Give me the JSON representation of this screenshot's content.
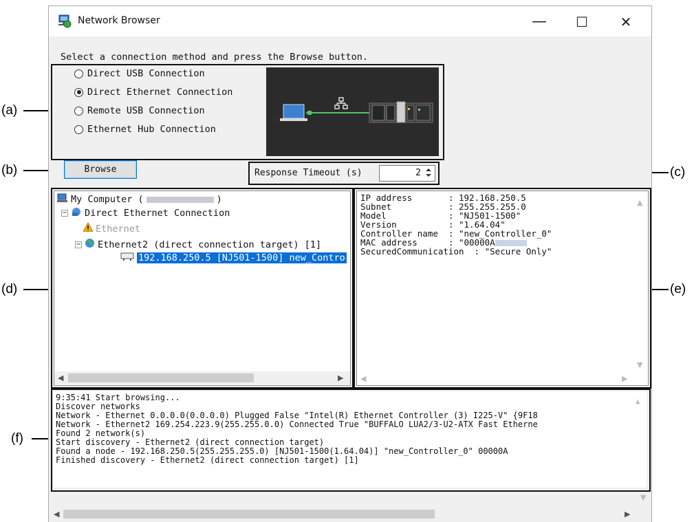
{
  "window": {
    "title": "Network Browser",
    "min_label": "—",
    "max_label": "☐",
    "close_label": "✕"
  },
  "instruction": "Select a connection method and press the Browse button.",
  "connection_methods": [
    {
      "label": "Direct USB Connection",
      "selected": false
    },
    {
      "label": "Direct Ethernet Connection",
      "selected": true
    },
    {
      "label": "Remote USB Connection",
      "selected": false
    },
    {
      "label": "Ethernet Hub Connection",
      "selected": false
    }
  ],
  "browse_label": "Browse",
  "timeout": {
    "label": "Response Timeout (s)",
    "value": "2"
  },
  "tree": {
    "root_prefix": "My Computer (",
    "root_suffix": ")",
    "items": [
      "Direct Ethernet Connection",
      "Ethernet",
      "Ethernet2 (direct connection target) [1]",
      "192.168.250.5 [NJ501-1500] new_Contro"
    ]
  },
  "info": {
    "rows": [
      {
        "key": "IP address       ",
        "value": ": 192.168.250.5"
      },
      {
        "key": "Subnet           ",
        "value": ": 255.255.255.0"
      },
      {
        "key": "Model            ",
        "value": ": \"NJ501-1500\""
      },
      {
        "key": "Version          ",
        "value": ": \"1.64.04\""
      },
      {
        "key": "Controller name  ",
        "value": ": \"new_Controller_0\""
      },
      {
        "key": "MAC address      ",
        "value": ": \"00000A"
      },
      {
        "key": "SecuredCommunication",
        "value": "  : \"Secure Only\""
      }
    ]
  },
  "log": [
    "9:35:41 Start browsing...",
    "Discover networks",
    "Network - Ethernet 0.0.0.0(0.0.0.0) Plugged False \"Intel(R) Ethernet Controller (3) I225-V\" {9F18",
    "Network - Ethernet2 169.254.223.9(255.255.0.0) Connected True \"BUFFALO LUA2/3-U2-ATX Fast Etherne",
    "Found 2 network(s)",
    "Start discovery - Ethernet2 (direct connection target)",
    "Found a node - 192.168.250.5(255.255.255.0) [NJ501-1500(1.64.04)] \"new_Controller_0\" 00000A",
    "Finished discovery - Ethernet2 (direct connection target) [1]"
  ],
  "callouts": {
    "a": "(a)",
    "b": "(b)",
    "c": "(c)",
    "d": "(d)",
    "e": "(e)",
    "f": "(f)"
  },
  "icons": [
    "network-browser-icon",
    "computer-icon",
    "network-icon",
    "warning-icon",
    "globe-icon",
    "controller-icon",
    "switch-icon"
  ]
}
